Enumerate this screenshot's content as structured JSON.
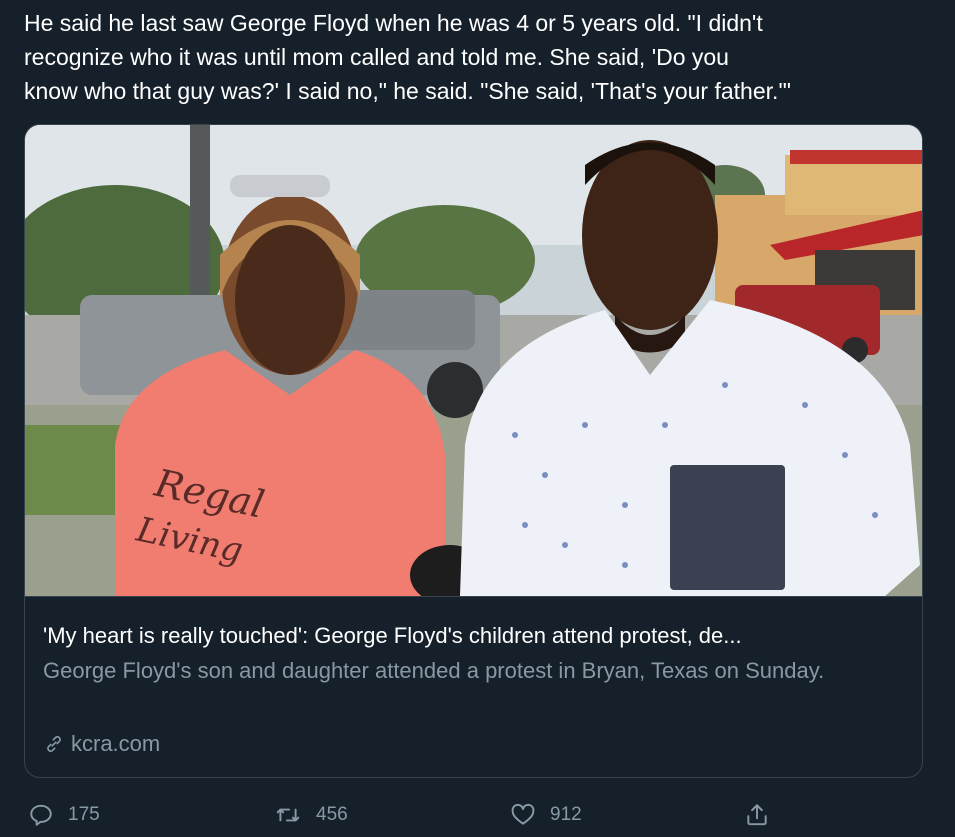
{
  "tweet": {
    "text_lines": [
      "He said he last saw George Floyd when he was 4 or 5 years old. \"I didn't",
      "recognize who it was until mom called and told me. She said, 'Do you",
      "know who that guy was?' I said no,\" he said. \"She said, 'That's your father.'\""
    ]
  },
  "card": {
    "shirt_text_line1": "Regal",
    "shirt_text_line2": "Living",
    "title": "'My heart is really touched': George Floyd's children attend protest, de...",
    "description": "George Floyd's son and daughter attended a protest in Bryan, Texas on Sunday.",
    "domain": "kcra.com"
  },
  "actions": {
    "reply_count": "175",
    "retweet_count": "456",
    "like_count": "912"
  },
  "colors": {
    "background": "#15202b",
    "border": "#38444d",
    "muted_text": "#8899a6"
  },
  "icons": [
    "reply-icon",
    "retweet-icon",
    "like-icon",
    "share-icon",
    "link-icon"
  ]
}
